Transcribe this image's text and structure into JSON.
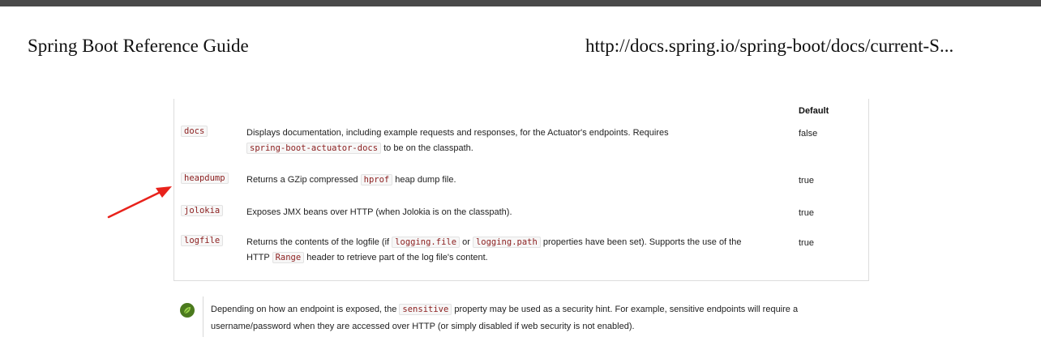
{
  "header": {
    "title": "Spring Boot Reference Guide",
    "url": "http://docs.spring.io/spring-boot/docs/current-S..."
  },
  "table": {
    "default_header": "Default",
    "rows": [
      {
        "id": "docs",
        "desc_1": "Displays documentation, including example requests and responses, for the Actuator's endpoints. Requires",
        "code_1": "spring-boot-actuator-docs",
        "desc_2": "to be on the classpath.",
        "default": "false"
      },
      {
        "id": "heapdump",
        "desc_1": "Returns a GZip compressed",
        "code_1": "hprof",
        "desc_2": "heap dump file.",
        "default": "true"
      },
      {
        "id": "jolokia",
        "desc_1": "Exposes JMX beans over HTTP (when Jolokia is on the classpath).",
        "default": "true"
      },
      {
        "id": "logfile",
        "desc_1": "Returns the contents of the logfile (if",
        "code_1": "logging.file",
        "desc_2": "or",
        "code_2": "logging.path",
        "desc_3": "properties have been set). Supports the use of the",
        "desc_4": "HTTP",
        "code_3": "Range",
        "desc_5": "header to retrieve part of the log file's content.",
        "default": "true"
      }
    ]
  },
  "note": {
    "icon": "spring-leaf-icon",
    "text_1": "Depending on how an endpoint is exposed, the",
    "code": "sensitive",
    "text_2": "property may be used as a security hint. For example, sensitive endpoints will require a username/password when they are accessed over HTTP (or simply disabled if web security is not enabled)."
  },
  "annotation": {
    "arrow_color": "#e8221b"
  },
  "colors": {
    "code_text": "#8b1e1e",
    "note_icon": "#4b7a1e"
  }
}
